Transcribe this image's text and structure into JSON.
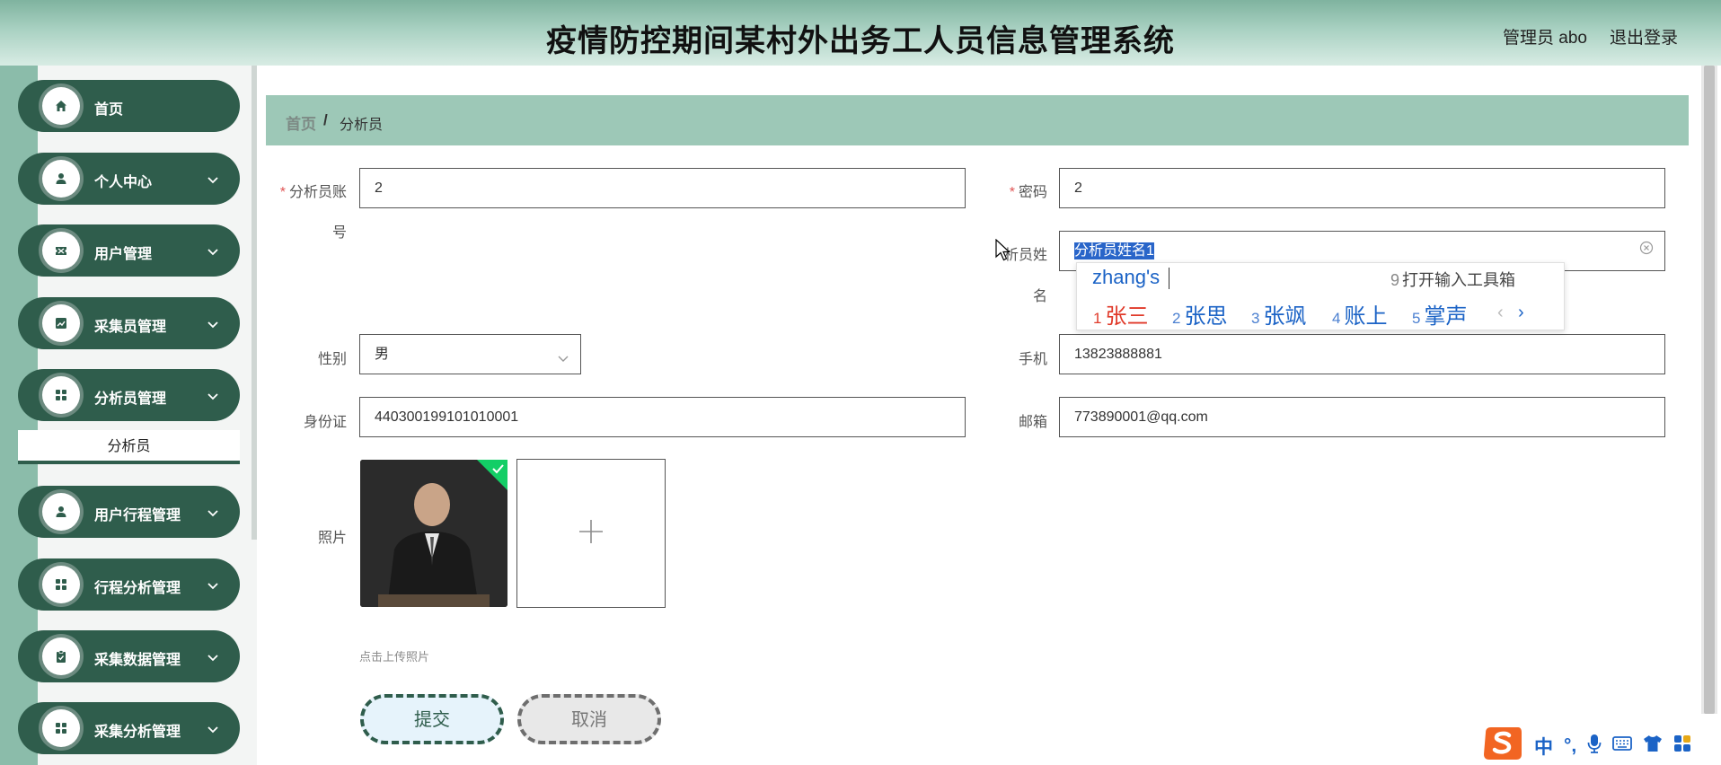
{
  "header": {
    "title": "疫情防控期间某村外出务工人员信息管理系统",
    "user": "管理员 abo",
    "logout": "退出登录"
  },
  "sidebar": {
    "items": [
      {
        "label": "首页",
        "icon": "home-icon"
      },
      {
        "label": "个人中心",
        "icon": "person-icon"
      },
      {
        "label": "用户管理",
        "icon": "ticket-icon"
      },
      {
        "label": "采集员管理",
        "icon": "chart-icon"
      },
      {
        "label": "分析员管理",
        "icon": "grid-icon"
      },
      {
        "label": "用户行程管理",
        "icon": "person-icon"
      },
      {
        "label": "行程分析管理",
        "icon": "grid-icon"
      },
      {
        "label": "采集数据管理",
        "icon": "clipboard-icon"
      },
      {
        "label": "采集分析管理",
        "icon": "grid-icon"
      }
    ],
    "sub_item": "分析员"
  },
  "breadcrumb": {
    "home": "首页",
    "separator": "/",
    "current": "分析员"
  },
  "form": {
    "account": {
      "label_1": "分析员账",
      "label_2": "号",
      "value": "2"
    },
    "password": {
      "label": "密码",
      "value": "2"
    },
    "name": {
      "label_1": "析员姓",
      "label_2": "名",
      "value": "分析员姓名1"
    },
    "gender": {
      "label": "性别",
      "value": "男"
    },
    "phone": {
      "label": "手机",
      "value": "13823888881"
    },
    "idcard": {
      "label": "身份证",
      "value": "440300199101010001"
    },
    "email": {
      "label": "邮箱",
      "value": "773890001@qq.com"
    },
    "photo": {
      "label": "照片",
      "hint": "点击上传照片"
    },
    "required_mark": "*"
  },
  "buttons": {
    "submit": "提交",
    "cancel": "取消"
  },
  "ime": {
    "pinyin": "zhang's",
    "tool": {
      "num": "9",
      "label": "打开输入工具箱"
    },
    "candidates": [
      {
        "num": "1",
        "text": "张三"
      },
      {
        "num": "2",
        "text": "张思"
      },
      {
        "num": "3",
        "text": "张飒"
      },
      {
        "num": "4",
        "text": "账上"
      },
      {
        "num": "5",
        "text": "掌声"
      }
    ],
    "prev": "‹",
    "next": "›",
    "bar_mode": "中",
    "bar_punct": "°,"
  },
  "colors": {
    "accent": "#2f5d4c",
    "breadcrumb_bg": "#9dc8b7",
    "header_bg": "#a9d1c2",
    "ime_blue": "#1b63c6",
    "ime_red": "#e03a2a",
    "required": "#e05555"
  }
}
